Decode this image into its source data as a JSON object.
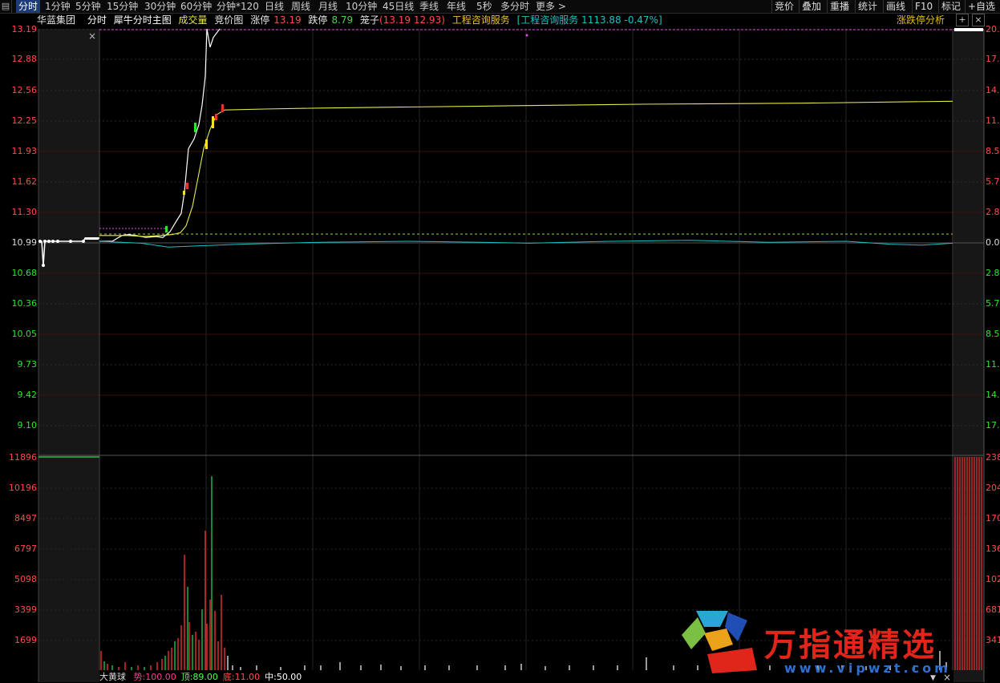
{
  "toolbar": {
    "lead_icon": "menu-icon",
    "tabs": [
      "分时",
      "1分钟",
      "5分钟",
      "15分钟",
      "30分钟",
      "60分钟",
      "分钟*120",
      "日线",
      "周线",
      "月线",
      "10分钟",
      "45日线",
      "季线",
      "年线",
      "5秒",
      "多分时",
      "更多 >"
    ],
    "right_buttons": [
      "竞价",
      "叠加",
      "重播",
      "统计",
      "画线",
      "F10",
      "标记",
      "+自选"
    ]
  },
  "info": {
    "stock_name": "华蓝集团",
    "view_name": "分时",
    "indicator_name": "犀牛分时主图",
    "volume_label": "成交量",
    "auction_label": "竞价图",
    "limit_up_label": "涨停",
    "limit_up_value": "13.19",
    "limit_down_label": "跌停",
    "limit_down_value": "8.79",
    "cage_label": "笼子",
    "cage_value": "(13.19 12.93)",
    "sector_name": "工程咨询服务",
    "sector_index": "[工程咨询服务 1113.88 -0.47%]",
    "analysis_link": "涨跌停分析",
    "close_symbol": "×",
    "add_symbol": "+",
    "remove_symbol": "×"
  },
  "price_axis": {
    "labels": [
      "13.19",
      "12.88",
      "12.56",
      "12.25",
      "11.93",
      "11.62",
      "11.30",
      "10.99",
      "10.68",
      "10.36",
      "10.05",
      "9.73",
      "9.42",
      "9.10"
    ],
    "reference_price": "10.99"
  },
  "percent_axis": {
    "labels": [
      "20.",
      "17.",
      "14.",
      "11.",
      "8.5",
      "5.7",
      "2.8",
      "0.0",
      "2.8",
      "5.7",
      "8.5",
      "11.",
      "14.",
      "17."
    ]
  },
  "volume_axis": {
    "left_labels": [
      "11896",
      "10196",
      "8497",
      "6797",
      "5098",
      "3399",
      "1699"
    ],
    "right_labels": [
      "238",
      "204",
      "170",
      "136",
      "102",
      "681",
      "341"
    ]
  },
  "bottom_indicator": {
    "name": "大黄球",
    "items": [
      {
        "label": "势:",
        "value": "100.00",
        "color": "#ff3d8c"
      },
      {
        "label": "顶:",
        "value": "89.00",
        "color": "#4cff4c"
      },
      {
        "label": "底:",
        "value": "11.00",
        "color": "#ff4b4b"
      },
      {
        "label": "中:",
        "value": "50.00",
        "color": "#ffffff"
      }
    ]
  },
  "watermark": {
    "text": "万指通精选",
    "url": "www.vipwzt.com"
  },
  "colors": {
    "price_line": "#ffffff",
    "avg_line": "#e8e84a",
    "index_line": "#19c3c3",
    "up": "#e8322e",
    "down": "#19c24a",
    "limit_line": "#e050e0",
    "ref_line": "#9bd63b"
  },
  "chart_data": {
    "type": "line",
    "series": [
      {
        "values": [
          10.99,
          10.99,
          10.99,
          10.99,
          11.02,
          11.05,
          11.06,
          11.05,
          11.03,
          11.04,
          11.03,
          11.05,
          11.09,
          11.2,
          11.28,
          11.5,
          11.95,
          12.05,
          12.2,
          12.4,
          12.7,
          13.19,
          13.0,
          13.1,
          13.19
        ]
      },
      {
        "values": [
          11.05,
          11.05,
          11.04,
          11.05,
          11.06,
          11.08,
          11.15,
          11.35,
          11.65,
          11.95,
          12.15,
          12.3,
          12.35,
          12.36,
          12.37,
          12.38,
          12.39,
          12.4,
          12.41,
          12.42,
          12.44
        ]
      },
      {
        "values": [
          10.99,
          10.97,
          10.93,
          10.96,
          10.98,
          10.99,
          10.98,
          10.97,
          10.99,
          11.0,
          10.98,
          10.99,
          10.96,
          10.95,
          10.97
        ]
      }
    ],
    "ylim": [
      8.79,
      13.19
    ]
  }
}
